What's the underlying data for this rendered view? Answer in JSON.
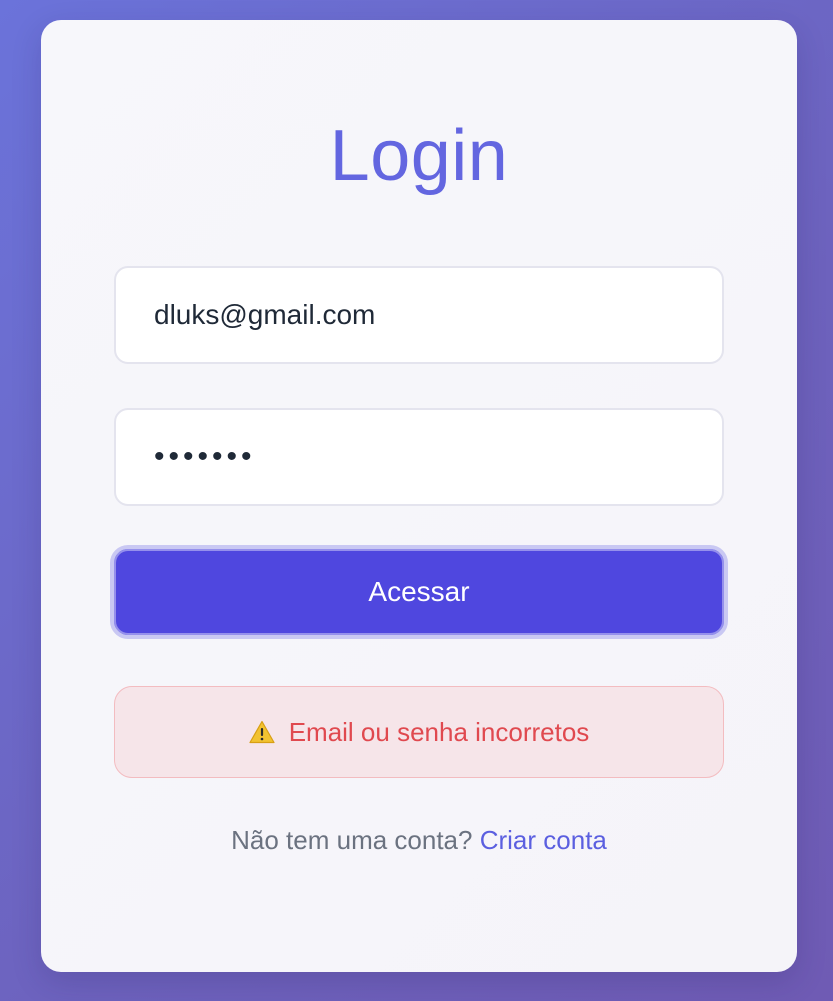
{
  "login": {
    "title": "Login",
    "email_value": "dluks@gmail.com",
    "password_value": "•••••••",
    "submit_label": "Acessar",
    "error_message": "Email ou senha incorretos",
    "error_icon": "warning-icon",
    "footer_text": "Não tem uma conta?",
    "footer_link": "Criar conta"
  },
  "colors": {
    "accent": "#4f47df",
    "title": "#6366e0",
    "error_text": "#e0494f",
    "error_bg": "#f6e5e9"
  }
}
